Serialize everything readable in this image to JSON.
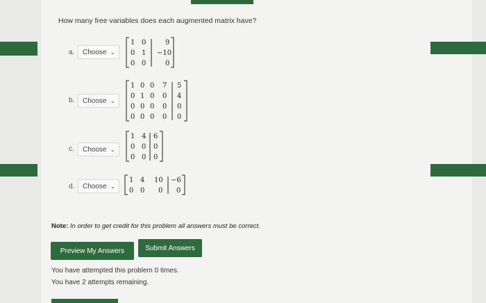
{
  "question": "How many free variables does each augmented matrix have?",
  "items": [
    {
      "letter": "a.",
      "select": "Choose",
      "rows": [
        [
          "1",
          "0",
          "9"
        ],
        [
          "0",
          "1",
          "−10"
        ],
        [
          "0",
          "0",
          "0"
        ]
      ]
    },
    {
      "letter": "b.",
      "select": "Choose",
      "rows": [
        [
          "1",
          "0",
          "0",
          "7",
          "5"
        ],
        [
          "0",
          "1",
          "0",
          "0",
          "4"
        ],
        [
          "0",
          "0",
          "0",
          "0",
          "0"
        ],
        [
          "0",
          "0",
          "0",
          "0",
          "0"
        ]
      ]
    },
    {
      "letter": "c.",
      "select": "Choose",
      "rows": [
        [
          "1",
          "4",
          "6"
        ],
        [
          "0",
          "0",
          "0"
        ],
        [
          "0",
          "0",
          "0"
        ]
      ]
    },
    {
      "letter": "d.",
      "select": "Choose",
      "rows": [
        [
          "1",
          "4",
          "10",
          "−6"
        ],
        [
          "0",
          "0",
          "0",
          "0"
        ]
      ]
    }
  ],
  "note": {
    "label": "Note:",
    "text": "In order to get credit for this problem all answers must be correct."
  },
  "buttons": {
    "preview": "Preview My Answers",
    "submit": "Submit Answers"
  },
  "status": {
    "attempted": "You have attempted this problem 0 times.",
    "remaining": "You have 2 attempts remaining."
  },
  "colors": {
    "accent": "#2e6b3c",
    "background": "#f3f3f1"
  }
}
